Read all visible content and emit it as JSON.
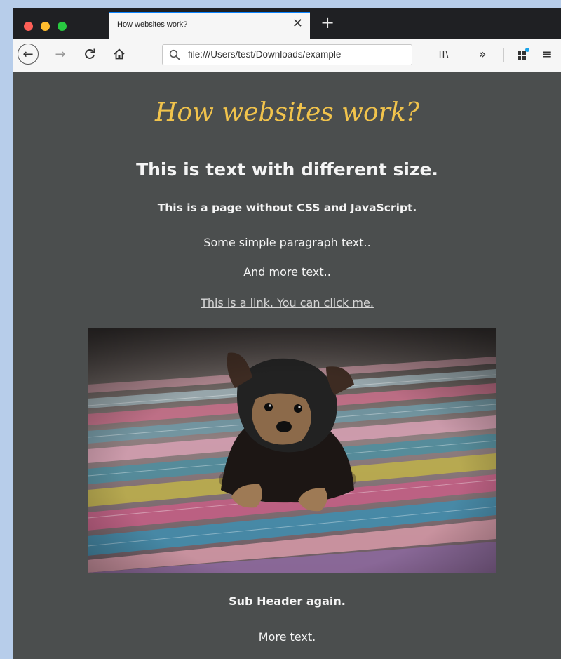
{
  "browser": {
    "tab": {
      "title": "How websites work?",
      "close_glyph": "✕"
    },
    "new_tab_glyph": "+",
    "toolbar": {
      "back_glyph": "←",
      "forward_glyph": "→",
      "reload_glyph": "C",
      "url": "file:///Users/test/Downloads/example",
      "library_glyph": "II\\",
      "overflow_glyph": "»",
      "menu_glyph": "≡"
    }
  },
  "page": {
    "title": "How websites work?",
    "heading": "This is text with different size.",
    "subheading": "This is a page without CSS and JavaScript.",
    "paragraph_1": "Some simple paragraph text..",
    "paragraph_2": "And more text..",
    "link_text": "This is a link. You can click me.",
    "sub_header": "Sub Header again.",
    "paragraph_3": "More text."
  },
  "colors": {
    "page_background": "#4b4e4e",
    "title_color": "#f1c34c",
    "desktop_background": "#b7cdea"
  }
}
